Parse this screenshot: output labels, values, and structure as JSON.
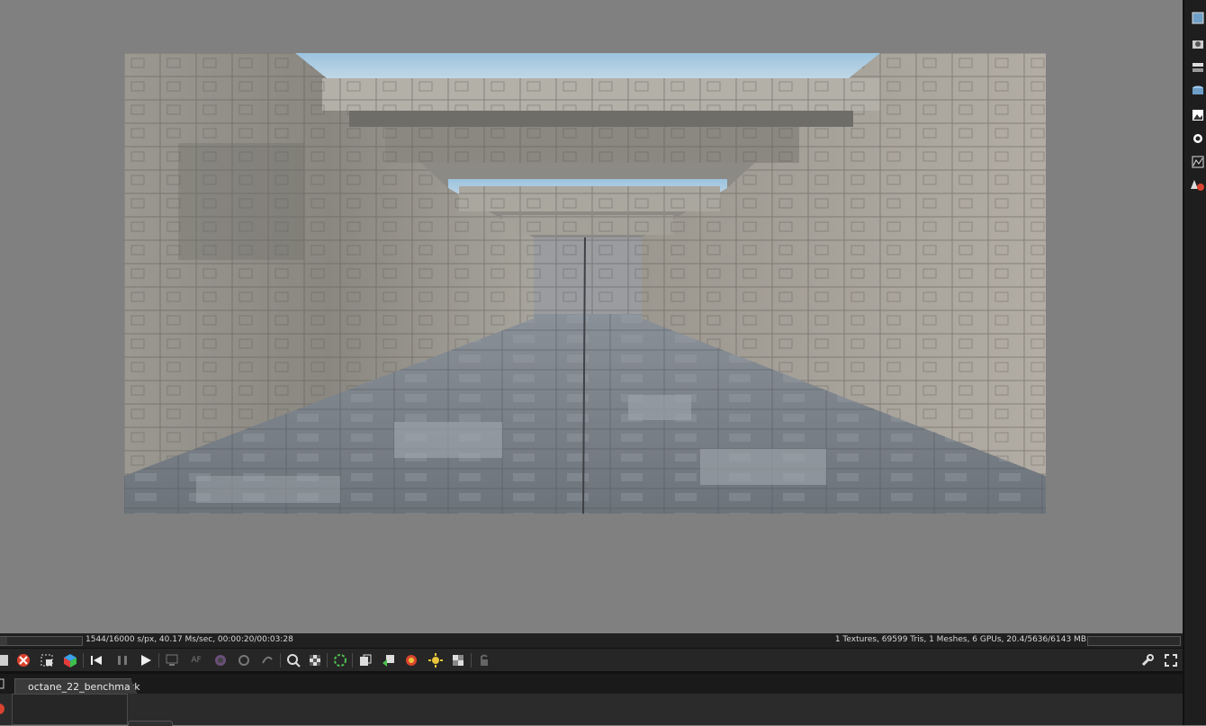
{
  "viewport": {
    "background": "#808080",
    "render_image": "octane benchmark render — concrete corridor with blocky walls"
  },
  "status_bar": {
    "left_text": "1544/16000 s/px, 40.17 Ms/sec, 00:00:20/00:03:28",
    "right_text": "1 Textures, 69599 Tris, 1 Meshes, 6 GPUs, 20.4/5636/6143 MB",
    "render_progress": 0.0965,
    "memory_progress": 0.0
  },
  "toolbar": {
    "icons": [
      "stop-render-icon",
      "reset-camera-icon",
      "region-render-icon",
      "rgb-cube-icon",
      "restart-render-icon",
      "pause-icon",
      "play-icon",
      "display-icon",
      "af-icon",
      "color-wheel-icon",
      "refresh-icon",
      "rotate-icon",
      "zoom-icon",
      "checker-icon",
      "spinner-icon",
      "copy-icon",
      "export-icon",
      "color-picker-icon",
      "light-icon",
      "material-picker-icon",
      "lock-icon"
    ],
    "af_label": "AF"
  },
  "right_toolbar": {
    "icons": [
      "render-image-icon",
      "camera-icon",
      "layer-icon",
      "object-icon",
      "image-icon",
      "sun-icon",
      "histogram-icon",
      "material-icon"
    ]
  },
  "tabs": {
    "active": "octane_22_benchmark"
  },
  "colors": {
    "panel": "#262626",
    "statusbar": "#202020",
    "accent_red": "#d9432f",
    "accent_yellow": "#e8c53a"
  }
}
